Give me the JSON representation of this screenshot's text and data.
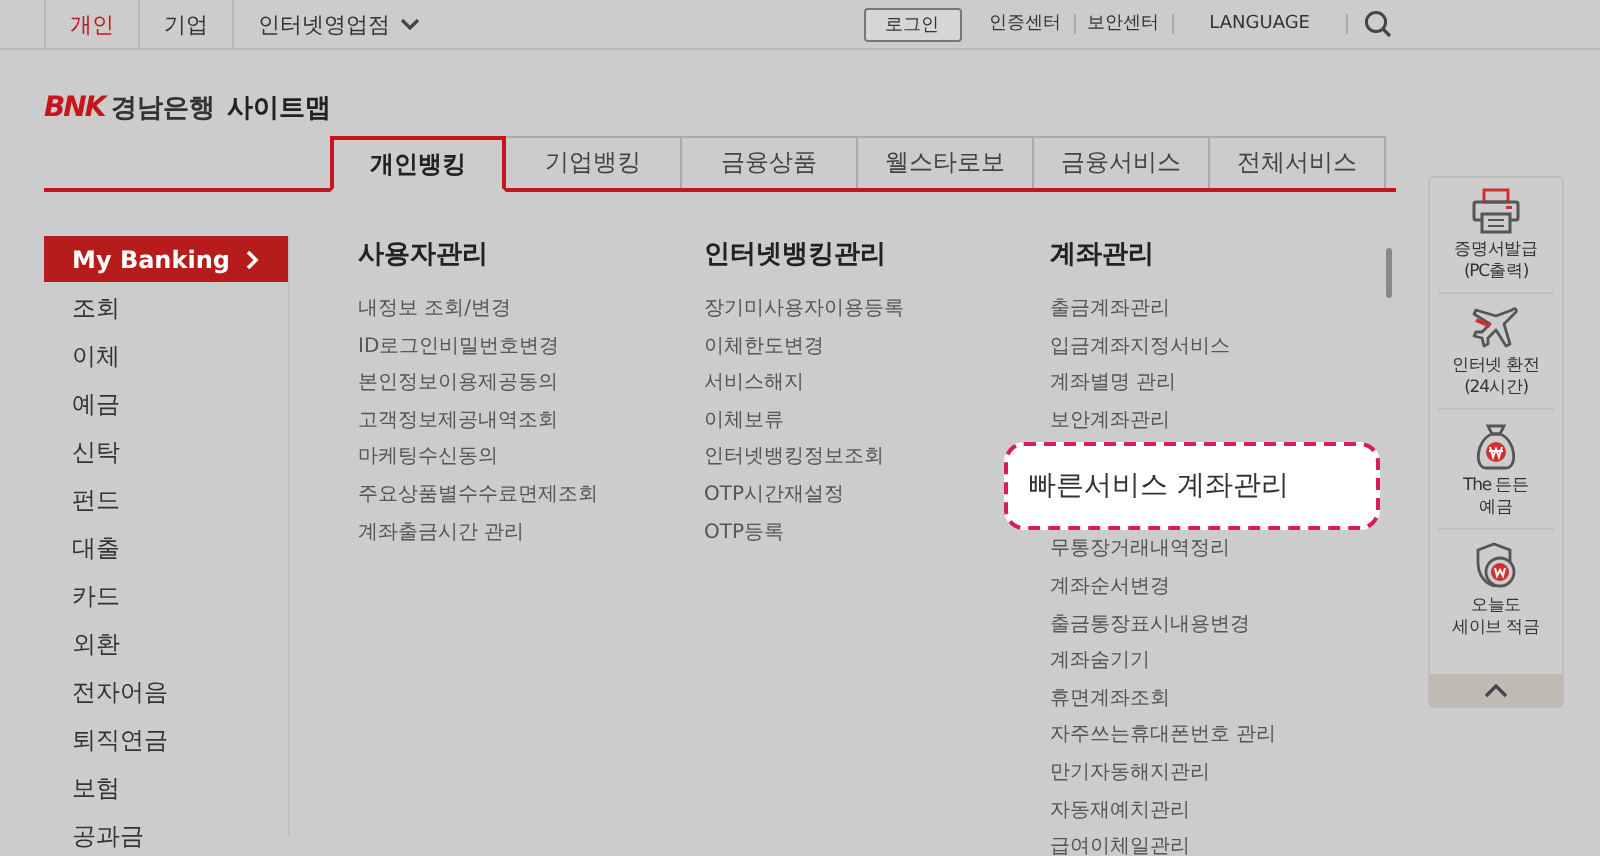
{
  "top_nav": [
    {
      "label": "개인",
      "selected": true
    },
    {
      "label": "기업",
      "selected": false
    },
    {
      "label": "인터넷영업점",
      "selected": false,
      "dropdown": true
    }
  ],
  "utility": {
    "login": "로그인",
    "links": [
      "인증센터",
      "보안센터",
      "LANGUAGE"
    ]
  },
  "header": {
    "brand": "BNK",
    "bank": "경남은행",
    "title": "사이트맵"
  },
  "tabs": [
    {
      "label": "개인뱅킹",
      "selected": true
    },
    {
      "label": "기업뱅킹",
      "selected": false
    },
    {
      "label": "금융상품",
      "selected": false
    },
    {
      "label": "웰스타로보",
      "selected": false
    },
    {
      "label": "금융서비스",
      "selected": false
    },
    {
      "label": "전체서비스",
      "selected": false
    }
  ],
  "sidebar": {
    "items": [
      {
        "label": "My Banking",
        "selected": true
      },
      {
        "label": "조회",
        "selected": false
      },
      {
        "label": "이체",
        "selected": false
      },
      {
        "label": "예금",
        "selected": false
      },
      {
        "label": "신탁",
        "selected": false
      },
      {
        "label": "펀드",
        "selected": false
      },
      {
        "label": "대출",
        "selected": false
      },
      {
        "label": "카드",
        "selected": false
      },
      {
        "label": "외환",
        "selected": false
      },
      {
        "label": "전자어음",
        "selected": false
      },
      {
        "label": "퇴직연금",
        "selected": false
      },
      {
        "label": "보험",
        "selected": false
      },
      {
        "label": "공과금",
        "selected": false
      }
    ]
  },
  "columns": [
    {
      "heading": "사용자관리",
      "items": [
        {
          "kind": "link",
          "label": "내정보 조회/변경"
        },
        {
          "kind": "link",
          "label": "ID로그인비밀번호변경"
        },
        {
          "kind": "link",
          "label": "본인정보이용제공동의"
        },
        {
          "kind": "link",
          "label": "고객정보제공내역조회"
        },
        {
          "kind": "link",
          "label": "마케팅수신동의"
        },
        {
          "kind": "link",
          "label": "주요상품별수수료면제조회"
        },
        {
          "kind": "link",
          "label": "계좌출금시간 관리"
        }
      ]
    },
    {
      "heading": "인터넷뱅킹관리",
      "items": [
        {
          "kind": "link",
          "label": "장기미사용자이용등록"
        },
        {
          "kind": "link",
          "label": "이체한도변경"
        },
        {
          "kind": "link",
          "label": "서비스해지"
        },
        {
          "kind": "link",
          "label": "이체보류"
        },
        {
          "kind": "link",
          "label": "인터넷뱅킹정보조회"
        },
        {
          "kind": "link",
          "label": "OTP시간재설정"
        },
        {
          "kind": "link",
          "label": "OTP등록"
        }
      ]
    },
    {
      "heading": "계좌관리",
      "items": [
        {
          "kind": "link",
          "label": "출금계좌관리"
        },
        {
          "kind": "link",
          "label": "입금계좌지정서비스"
        },
        {
          "kind": "link",
          "label": "계좌별명 관리"
        },
        {
          "kind": "link",
          "label": "보안계좌관리"
        },
        {
          "kind": "callout",
          "label": "빠른서비스 계좌관리"
        },
        {
          "kind": "link",
          "label": "무통장거래내역정리"
        },
        {
          "kind": "link",
          "label": "계좌순서변경"
        },
        {
          "kind": "link",
          "label": "출금통장표시내용변경"
        },
        {
          "kind": "link",
          "label": "계좌숨기기"
        },
        {
          "kind": "link",
          "label": "휴면계좌조회"
        },
        {
          "kind": "link",
          "label": "자주쓰는휴대폰번호 관리"
        },
        {
          "kind": "link",
          "label": "만기자동해지관리"
        },
        {
          "kind": "link",
          "label": "자동재예치관리"
        },
        {
          "kind": "link",
          "label": "급여이체일관리"
        }
      ]
    }
  ],
  "quick_menu": [
    {
      "kind": "printer",
      "label": "증명서발급\n(PC출력)"
    },
    {
      "kind": "plane",
      "label": "인터넷 환전\n(24시간)"
    },
    {
      "kind": "bag",
      "label": "The 든든\n예금"
    },
    {
      "kind": "coin",
      "label": "오늘도\n세이브 적금"
    }
  ]
}
